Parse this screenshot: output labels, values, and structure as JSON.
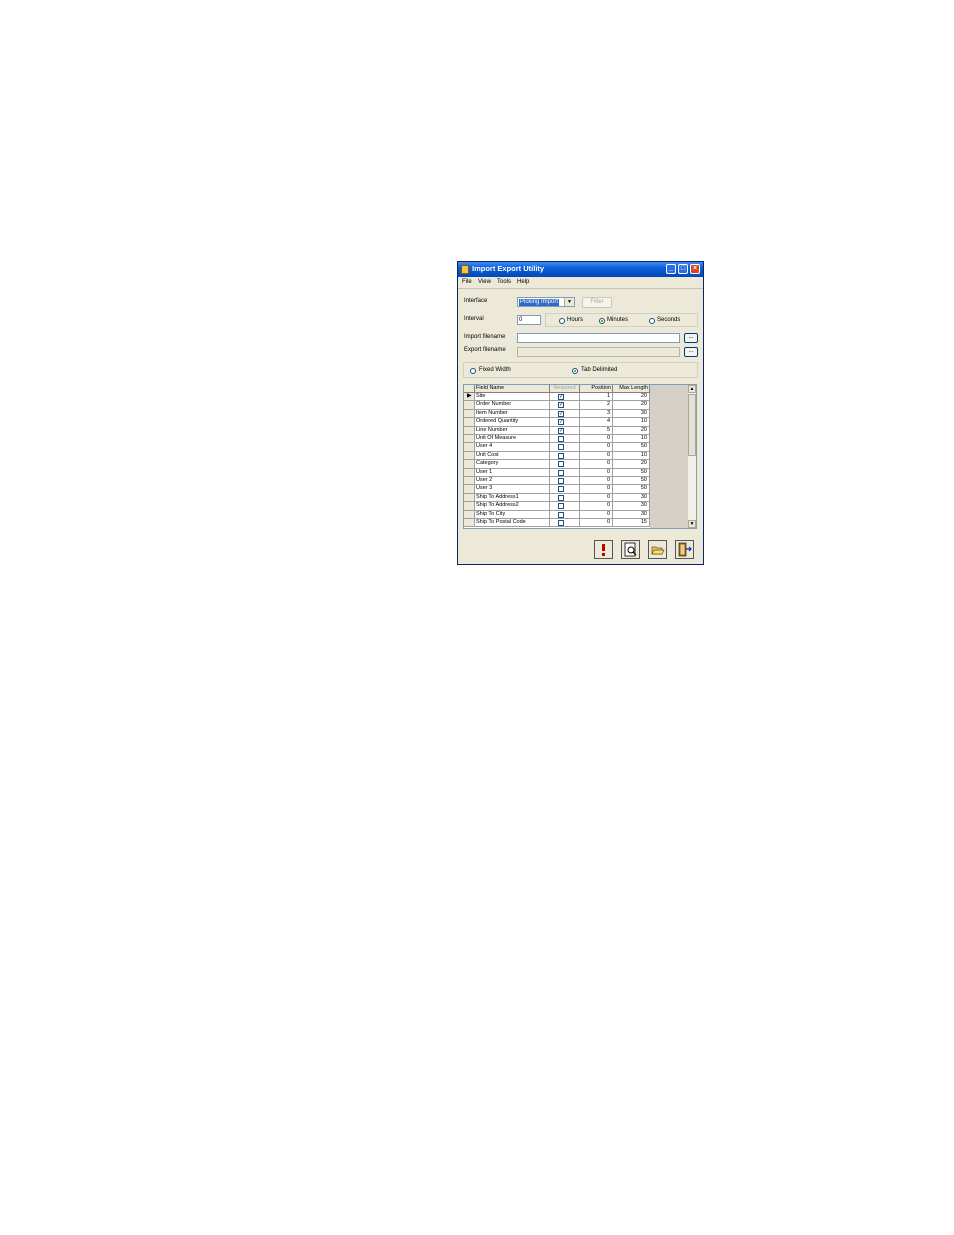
{
  "window": {
    "title": "Import Export Utility"
  },
  "menu": [
    "File",
    "View",
    "Tools",
    "Help"
  ],
  "form": {
    "interface_label": "Interface",
    "interface_value": "Picking Import",
    "filter_label": "Filter",
    "interval_label": "Interval",
    "interval_value": "0",
    "interval_units": [
      "Hours",
      "Minutes",
      "Seconds"
    ],
    "interval_selected": "Minutes",
    "import_label": "Import filename",
    "export_label": "Export filename",
    "import_value": "",
    "export_value": "",
    "browse_label": "...",
    "format_options": [
      "Fixed Width",
      "Tab Delimited"
    ],
    "format_selected": "Tab Delimited"
  },
  "grid": {
    "headers": [
      "Field Name",
      "Required",
      "Position",
      "Max Length"
    ],
    "rows": [
      {
        "name": "Site",
        "required": true,
        "position": "1",
        "max_length": "20"
      },
      {
        "name": "Order Number",
        "required": true,
        "position": "2",
        "max_length": "20"
      },
      {
        "name": "Item Number",
        "required": true,
        "position": "3",
        "max_length": "30"
      },
      {
        "name": "Ordered Quantity",
        "required": true,
        "position": "4",
        "max_length": "10"
      },
      {
        "name": "Line Number",
        "required": true,
        "position": "5",
        "max_length": "20"
      },
      {
        "name": "Unit Of Measure",
        "required": false,
        "position": "0",
        "max_length": "10"
      },
      {
        "name": "User 4",
        "required": false,
        "position": "0",
        "max_length": "50"
      },
      {
        "name": "Unit Cost",
        "required": false,
        "position": "0",
        "max_length": "10"
      },
      {
        "name": "Category",
        "required": false,
        "position": "0",
        "max_length": "20"
      },
      {
        "name": "User 1",
        "required": false,
        "position": "0",
        "max_length": "50"
      },
      {
        "name": "User 2",
        "required": false,
        "position": "0",
        "max_length": "50"
      },
      {
        "name": "User 3",
        "required": false,
        "position": "0",
        "max_length": "50"
      },
      {
        "name": "Ship To Address1",
        "required": false,
        "position": "0",
        "max_length": "30"
      },
      {
        "name": "Ship To Address2",
        "required": false,
        "position": "0",
        "max_length": "30"
      },
      {
        "name": "Ship To City",
        "required": false,
        "position": "0",
        "max_length": "30"
      },
      {
        "name": "Ship To Postal Code",
        "required": false,
        "position": "0",
        "max_length": "15"
      }
    ]
  },
  "toolbar": [
    {
      "icon": "run-icon"
    },
    {
      "icon": "preview-icon"
    },
    {
      "icon": "open-folder-icon"
    },
    {
      "icon": "exit-icon"
    }
  ]
}
